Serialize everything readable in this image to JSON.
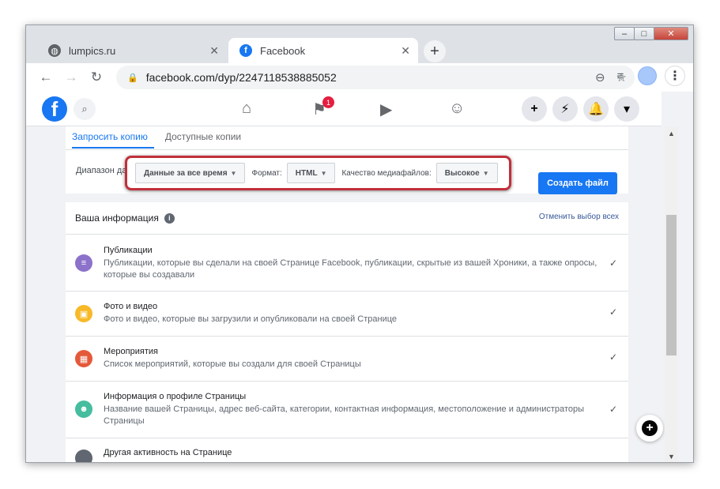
{
  "window_controls": {
    "minimize": "–",
    "maximize": "□",
    "close": "✕"
  },
  "tabs": [
    {
      "label": "lumpics.ru",
      "icon": "globe-icon",
      "close": "✕"
    },
    {
      "label": "Facebook",
      "icon": "facebook-icon",
      "close": "✕"
    }
  ],
  "new_tab": "+",
  "address": {
    "url": "facebook.com/dyp/2247118538885052"
  },
  "facebook": {
    "logo": "f",
    "notifications_badge": "1",
    "right_buttons": [
      "+",
      "⚡",
      "🔔",
      "▾"
    ]
  },
  "export": {
    "tabs": [
      "Запросить копию",
      "Доступные копии"
    ],
    "range_label": "Диапазон да",
    "date_range": "Данные за все время",
    "format_label": "Формат:",
    "format": "HTML",
    "quality_label": "Качество медиафайлов:",
    "quality": "Высокое",
    "create_button": "Создать файл"
  },
  "info": {
    "header": "Ваша информация",
    "deselect_all": "Отменить выбор всех",
    "items": [
      {
        "title": "Публикации",
        "desc": "Публикации, которые вы сделали на своей Странице Facebook, публикации, скрытые из вашей Хроники, а также опросы, которые вы создавали",
        "icon_color": "#8c72cb"
      },
      {
        "title": "Фото и видео",
        "desc": "Фото и видео, которые вы загрузили и опубликовали на своей Странице",
        "icon_color": "#f7b928"
      },
      {
        "title": "Мероприятия",
        "desc": "Список мероприятий, которые вы создали для своей Страницы",
        "icon_color": "#e4593a"
      },
      {
        "title": "Информация о профиле Страницы",
        "desc": "Название вашей Страницы, адрес веб-сайта, категории, контактная информация, местоположение и администраторы Страницы",
        "icon_color": "#45bd9e"
      },
      {
        "title": "Другая активность на Странице",
        "desc": "",
        "icon_color": "#606770"
      }
    ]
  }
}
